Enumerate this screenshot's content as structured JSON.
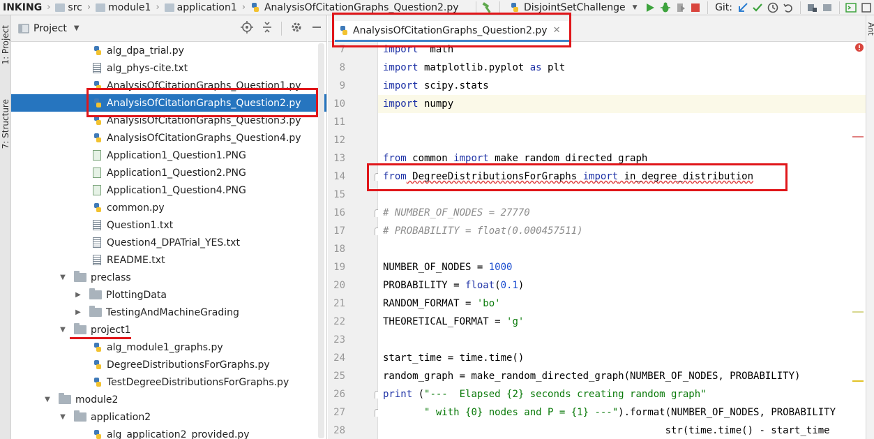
{
  "navbar": {
    "breadcrumbs": [
      "INKING",
      "src",
      "module1",
      "application1",
      "AnalysisOfCitationGraphs_Question2.py"
    ],
    "run_config": "DisjointSetChallenge",
    "git_label": "Git:"
  },
  "left_strip": {
    "project_tab": "1: Project",
    "structure_tab": "7: Structure"
  },
  "project_panel": {
    "title": "Project",
    "tree": [
      {
        "label": "alg_dpa_trial.py",
        "icon": "python-file-icon",
        "depth": 3
      },
      {
        "label": "alg_phys-cite.txt",
        "icon": "text-file-icon",
        "depth": 3
      },
      {
        "label": "AnalysisOfCitationGraphs_Question1.py",
        "icon": "python-file-icon",
        "depth": 3
      },
      {
        "label": "AnalysisOfCitationGraphs_Question2.py",
        "icon": "python-file-icon",
        "depth": 3,
        "selected": true
      },
      {
        "label": "AnalysisOfCitationGraphs_Question3.py",
        "icon": "python-file-icon",
        "depth": 3
      },
      {
        "label": "AnalysisOfCitationGraphs_Question4.py",
        "icon": "python-file-icon",
        "depth": 3
      },
      {
        "label": "Application1_Question1.PNG",
        "icon": "image-file-icon",
        "depth": 3
      },
      {
        "label": "Application1_Question2.PNG",
        "icon": "image-file-icon",
        "depth": 3
      },
      {
        "label": "Application1_Question4.PNG",
        "icon": "image-file-icon",
        "depth": 3
      },
      {
        "label": "common.py",
        "icon": "python-file-icon",
        "depth": 3
      },
      {
        "label": "Question1.txt",
        "icon": "text-file-icon",
        "depth": 3
      },
      {
        "label": "Question4_DPATrial_YES.txt",
        "icon": "text-file-icon",
        "depth": 3
      },
      {
        "label": "README.txt",
        "icon": "text-file-icon",
        "depth": 3
      },
      {
        "label": "preclass",
        "icon": "folder-icon",
        "depth": 2,
        "arrow": "open"
      },
      {
        "label": "PlottingData",
        "icon": "folder-icon",
        "depth": 3,
        "arrow": "closed"
      },
      {
        "label": "TestingAndMachineGrading",
        "icon": "folder-icon",
        "depth": 3,
        "arrow": "closed"
      },
      {
        "label": "project1",
        "icon": "folder-icon",
        "depth": 2,
        "arrow": "open"
      },
      {
        "label": "alg_module1_graphs.py",
        "icon": "python-file-icon",
        "depth": 3
      },
      {
        "label": "DegreeDistributionsForGraphs.py",
        "icon": "python-file-icon",
        "depth": 3
      },
      {
        "label": "TestDegreeDistributionsForGraphs.py",
        "icon": "python-file-icon",
        "depth": 3
      },
      {
        "label": "module2",
        "icon": "folder-icon",
        "depth": 1,
        "arrow": "open"
      },
      {
        "label": "application2",
        "icon": "folder-icon",
        "depth": 2,
        "arrow": "open"
      },
      {
        "label": "alg_application2_provided.py",
        "icon": "python-file-icon",
        "depth": 3
      }
    ]
  },
  "editor": {
    "active_tab": "AnalysisOfCitationGraphs_Question2.py",
    "right_strip_label": "Ant",
    "lines": [
      {
        "num": "7",
        "tokens": [
          [
            "kw",
            "import"
          ],
          [
            "",
            "  math"
          ]
        ]
      },
      {
        "num": "8",
        "tokens": [
          [
            "kw",
            "import"
          ],
          [
            "",
            " matplotlib.pyplot "
          ],
          [
            "kw",
            "as"
          ],
          [
            "",
            " plt"
          ]
        ]
      },
      {
        "num": "9",
        "tokens": [
          [
            "kw",
            "import"
          ],
          [
            "",
            " scipy.stats"
          ]
        ]
      },
      {
        "num": "10",
        "tokens": [
          [
            "kw",
            "import"
          ],
          [
            "",
            " numpy"
          ]
        ],
        "current": true
      },
      {
        "num": "11",
        "tokens": []
      },
      {
        "num": "12",
        "tokens": []
      },
      {
        "num": "13",
        "tokens": [
          [
            "kw",
            "from"
          ],
          [
            "",
            " common "
          ],
          [
            "kw",
            "import"
          ],
          [
            "",
            " make_random_directed_graph"
          ]
        ]
      },
      {
        "num": "14",
        "tokens": [
          [
            "kw",
            "from"
          ],
          [
            "squig",
            " DegreeDistributionsForGraphs "
          ],
          [
            "kw squig",
            "import"
          ],
          [
            "squig",
            " in_degree_distribution"
          ]
        ]
      },
      {
        "num": "15",
        "tokens": []
      },
      {
        "num": "16",
        "tokens": [
          [
            "cmt",
            "# NUMBER_OF_NODES = 27770"
          ]
        ]
      },
      {
        "num": "17",
        "tokens": [
          [
            "cmt",
            "# PROBABILITY = float(0.000457511)"
          ]
        ]
      },
      {
        "num": "18",
        "tokens": []
      },
      {
        "num": "19",
        "tokens": [
          [
            "",
            "NUMBER_OF_NODES = "
          ],
          [
            "num",
            "1000"
          ]
        ]
      },
      {
        "num": "20",
        "tokens": [
          [
            "",
            "PROBABILITY = "
          ],
          [
            "kw",
            "float"
          ],
          [
            "",
            "("
          ],
          [
            "num",
            "0.1"
          ],
          [
            "",
            ")"
          ]
        ]
      },
      {
        "num": "21",
        "tokens": [
          [
            "",
            "RANDOM_FORMAT = "
          ],
          [
            "str",
            "'bo'"
          ]
        ]
      },
      {
        "num": "22",
        "tokens": [
          [
            "",
            "THEORETICAL_FORMAT = "
          ],
          [
            "str",
            "'g'"
          ]
        ]
      },
      {
        "num": "23",
        "tokens": []
      },
      {
        "num": "24",
        "tokens": [
          [
            "",
            "start_time = time.time()"
          ]
        ]
      },
      {
        "num": "25",
        "tokens": [
          [
            "",
            "random_graph = make_random_directed_graph(NUMBER_OF_NODES, PROBABILITY)"
          ]
        ]
      },
      {
        "num": "26",
        "tokens": [
          [
            "kw",
            "print"
          ],
          [
            "",
            " ("
          ],
          [
            "str",
            "\"---  Elapsed {2} seconds creating random graph\""
          ]
        ]
      },
      {
        "num": "27",
        "tokens": [
          [
            "",
            "       "
          ],
          [
            "str",
            "\" with {0} nodes and P = {1} ---\""
          ],
          [
            "",
            ").format(NUMBER_OF_NODES, PROBABILITY"
          ]
        ]
      },
      {
        "num": "28",
        "tokens": [
          [
            "",
            "                                                str(time.time() - start_time"
          ]
        ]
      }
    ]
  }
}
